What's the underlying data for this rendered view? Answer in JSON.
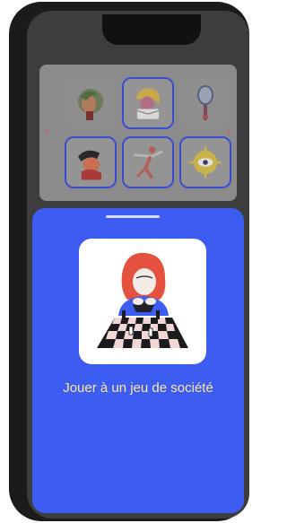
{
  "gallery": {
    "prev_arrow": "‹",
    "next_arrow": "›",
    "tiles": [
      {
        "icon": "portrait-leaves-illustration"
      },
      {
        "icon": "woman-reading-illustration"
      },
      {
        "icon": "mirror-illustration"
      },
      {
        "icon": "crying-person-illustration"
      },
      {
        "icon": "dancer-illustration"
      },
      {
        "icon": "sun-eye-illustration"
      }
    ]
  },
  "sheet": {
    "caption": "Jouer à un jeu de société",
    "illustration": "chess-player-illustration"
  },
  "colors": {
    "sheet_bg": "#3d5cf2",
    "caption": "#fbe9a0",
    "accent_border": "#3b4ccf"
  }
}
